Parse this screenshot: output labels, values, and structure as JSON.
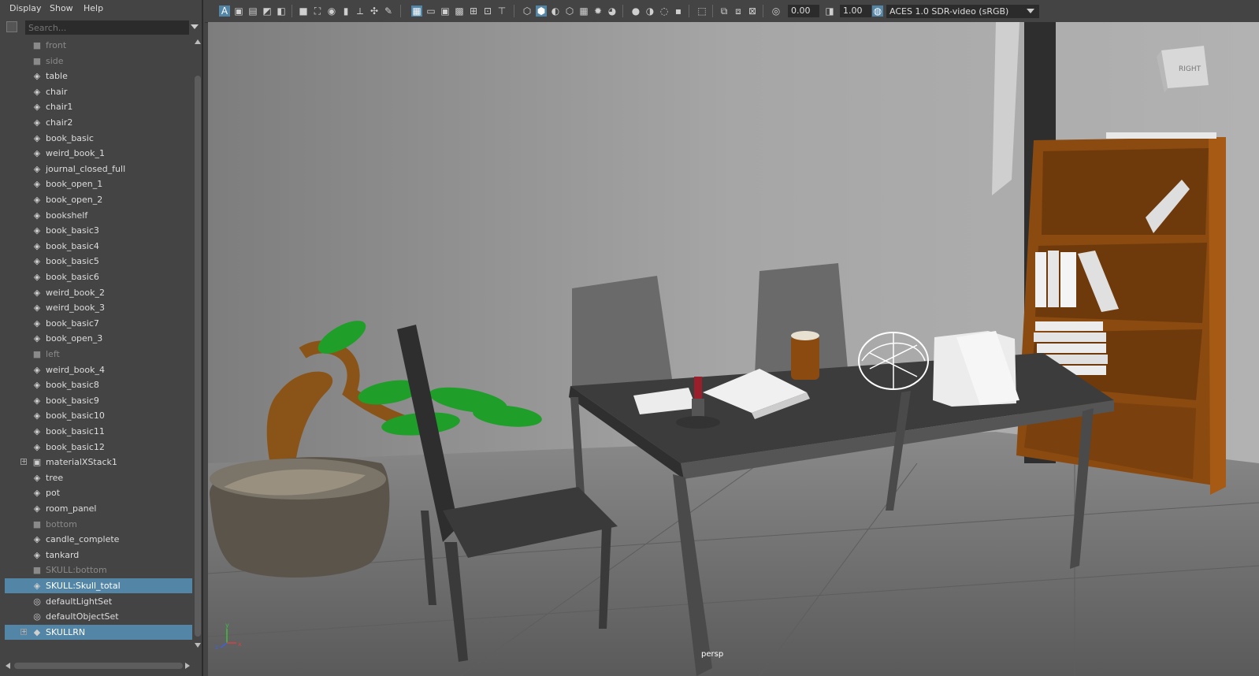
{
  "outliner": {
    "menu": [
      "Display",
      "Show",
      "Help"
    ],
    "search_placeholder": "Search...",
    "items": [
      {
        "label": "front",
        "icon": "camera-icon",
        "dim": true
      },
      {
        "label": "side",
        "icon": "camera-icon",
        "dim": true
      },
      {
        "label": "table",
        "icon": "transform-icon"
      },
      {
        "label": "chair",
        "icon": "transform-icon"
      },
      {
        "label": "chair1",
        "icon": "transform-icon"
      },
      {
        "label": "chair2",
        "icon": "transform-icon"
      },
      {
        "label": "book_basic",
        "icon": "transform-icon"
      },
      {
        "label": "weird_book_1",
        "icon": "transform-icon"
      },
      {
        "label": "journal_closed_full",
        "icon": "transform-icon"
      },
      {
        "label": "book_open_1",
        "icon": "transform-icon"
      },
      {
        "label": "book_open_2",
        "icon": "transform-icon"
      },
      {
        "label": "bookshelf",
        "icon": "transform-icon"
      },
      {
        "label": "book_basic3",
        "icon": "transform-icon"
      },
      {
        "label": "book_basic4",
        "icon": "transform-icon"
      },
      {
        "label": "book_basic5",
        "icon": "transform-icon"
      },
      {
        "label": "book_basic6",
        "icon": "transform-icon"
      },
      {
        "label": "weird_book_2",
        "icon": "transform-icon"
      },
      {
        "label": "weird_book_3",
        "icon": "transform-icon"
      },
      {
        "label": "book_basic7",
        "icon": "transform-icon"
      },
      {
        "label": "book_open_3",
        "icon": "transform-icon"
      },
      {
        "label": "left",
        "icon": "camera-icon",
        "dim": true
      },
      {
        "label": "weird_book_4",
        "icon": "transform-icon"
      },
      {
        "label": "book_basic8",
        "icon": "transform-icon"
      },
      {
        "label": "book_basic9",
        "icon": "transform-icon"
      },
      {
        "label": "book_basic10",
        "icon": "transform-icon"
      },
      {
        "label": "book_basic11",
        "icon": "transform-icon"
      },
      {
        "label": "book_basic12",
        "icon": "transform-icon"
      },
      {
        "label": "materialXStack1",
        "icon": "material-stack-icon",
        "expandable": true
      },
      {
        "label": "tree",
        "icon": "transform-icon"
      },
      {
        "label": "pot",
        "icon": "transform-icon"
      },
      {
        "label": "room_panel",
        "icon": "transform-icon"
      },
      {
        "label": "bottom",
        "icon": "camera-icon",
        "dim": true
      },
      {
        "label": "candle_complete",
        "icon": "transform-icon"
      },
      {
        "label": "tankard",
        "icon": "transform-icon"
      },
      {
        "label": "SKULL:bottom",
        "icon": "camera-icon",
        "dim": true
      },
      {
        "label": "SKULL:Skull_total",
        "icon": "transform-icon",
        "selected": true
      },
      {
        "label": "defaultLightSet",
        "icon": "set-icon"
      },
      {
        "label": "defaultObjectSet",
        "icon": "set-icon"
      },
      {
        "label": "SKULLRN",
        "icon": "reference-icon",
        "selected": true,
        "expandable": true
      }
    ]
  },
  "toolbar": {
    "exposure": "0.00",
    "gamma": "1.00",
    "color_space": "ACES 1.0 SDR-video (sRGB)"
  },
  "viewport": {
    "camera": "persp",
    "view_cube_label": "RIGHT",
    "axis_labels": {
      "x": "x",
      "y": "y",
      "z": "z"
    }
  },
  "colors": {
    "selection": "#5285a6",
    "panel": "#444444",
    "field": "#2b2b2b",
    "wall": "#a4a4a4",
    "floor": "#6e6e6e",
    "bookshelf": "#8a4a10",
    "tree_trunk": "#8a5418",
    "leaf": "#1f9e2a"
  }
}
